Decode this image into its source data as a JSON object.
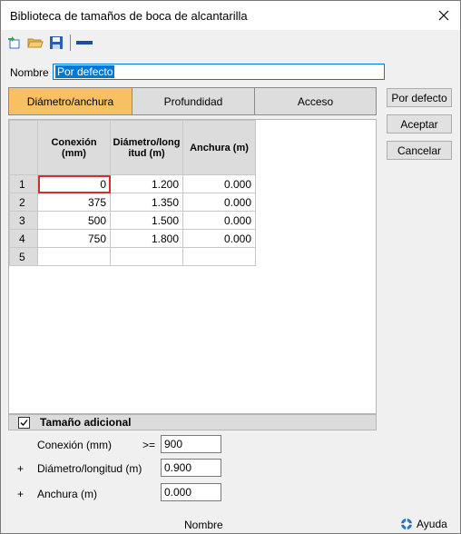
{
  "window": {
    "title": "Biblioteca de tamaños de boca de alcantarilla"
  },
  "toolbar": {
    "icons": [
      "new-icon",
      "open-folder-icon",
      "save-icon",
      "dash-icon"
    ]
  },
  "name_field": {
    "label": "Nombre",
    "value": "Por defecto"
  },
  "tabs": [
    {
      "label": "Diámetro/anchura",
      "active": true
    },
    {
      "label": "Profundidad",
      "active": false
    },
    {
      "label": "Acceso",
      "active": false
    }
  ],
  "buttons": {
    "default": "Por defecto",
    "accept": "Aceptar",
    "cancel": "Cancelar"
  },
  "table": {
    "headers": [
      "Conexión (mm)",
      "Diámetro/long itud (m)",
      "Anchura (m)"
    ],
    "rows": [
      {
        "num": "1",
        "cells": [
          "0",
          "1.200",
          "0.000"
        ]
      },
      {
        "num": "2",
        "cells": [
          "375",
          "1.350",
          "0.000"
        ]
      },
      {
        "num": "3",
        "cells": [
          "500",
          "1.500",
          "0.000"
        ]
      },
      {
        "num": "4",
        "cells": [
          "750",
          "1.800",
          "0.000"
        ]
      },
      {
        "num": "5",
        "cells": [
          "",
          "",
          ""
        ]
      }
    ]
  },
  "additional": {
    "label": "Tamaño adicional",
    "checked": true,
    "connection": {
      "label": "Conexión (mm)",
      "operator": ">=",
      "value": "900"
    },
    "diameter": {
      "prefix": "+",
      "label": "Diámetro/longitud (m)",
      "value": "0.900"
    },
    "width": {
      "prefix": "+",
      "label": "Anchura (m)",
      "value": "0.000"
    }
  },
  "status": {
    "name": "Nombre",
    "help": "Ayuda"
  },
  "colors": {
    "active_tab": "#f7c163",
    "selection": "#0078d7",
    "cell_highlight": "#d32f2f"
  }
}
